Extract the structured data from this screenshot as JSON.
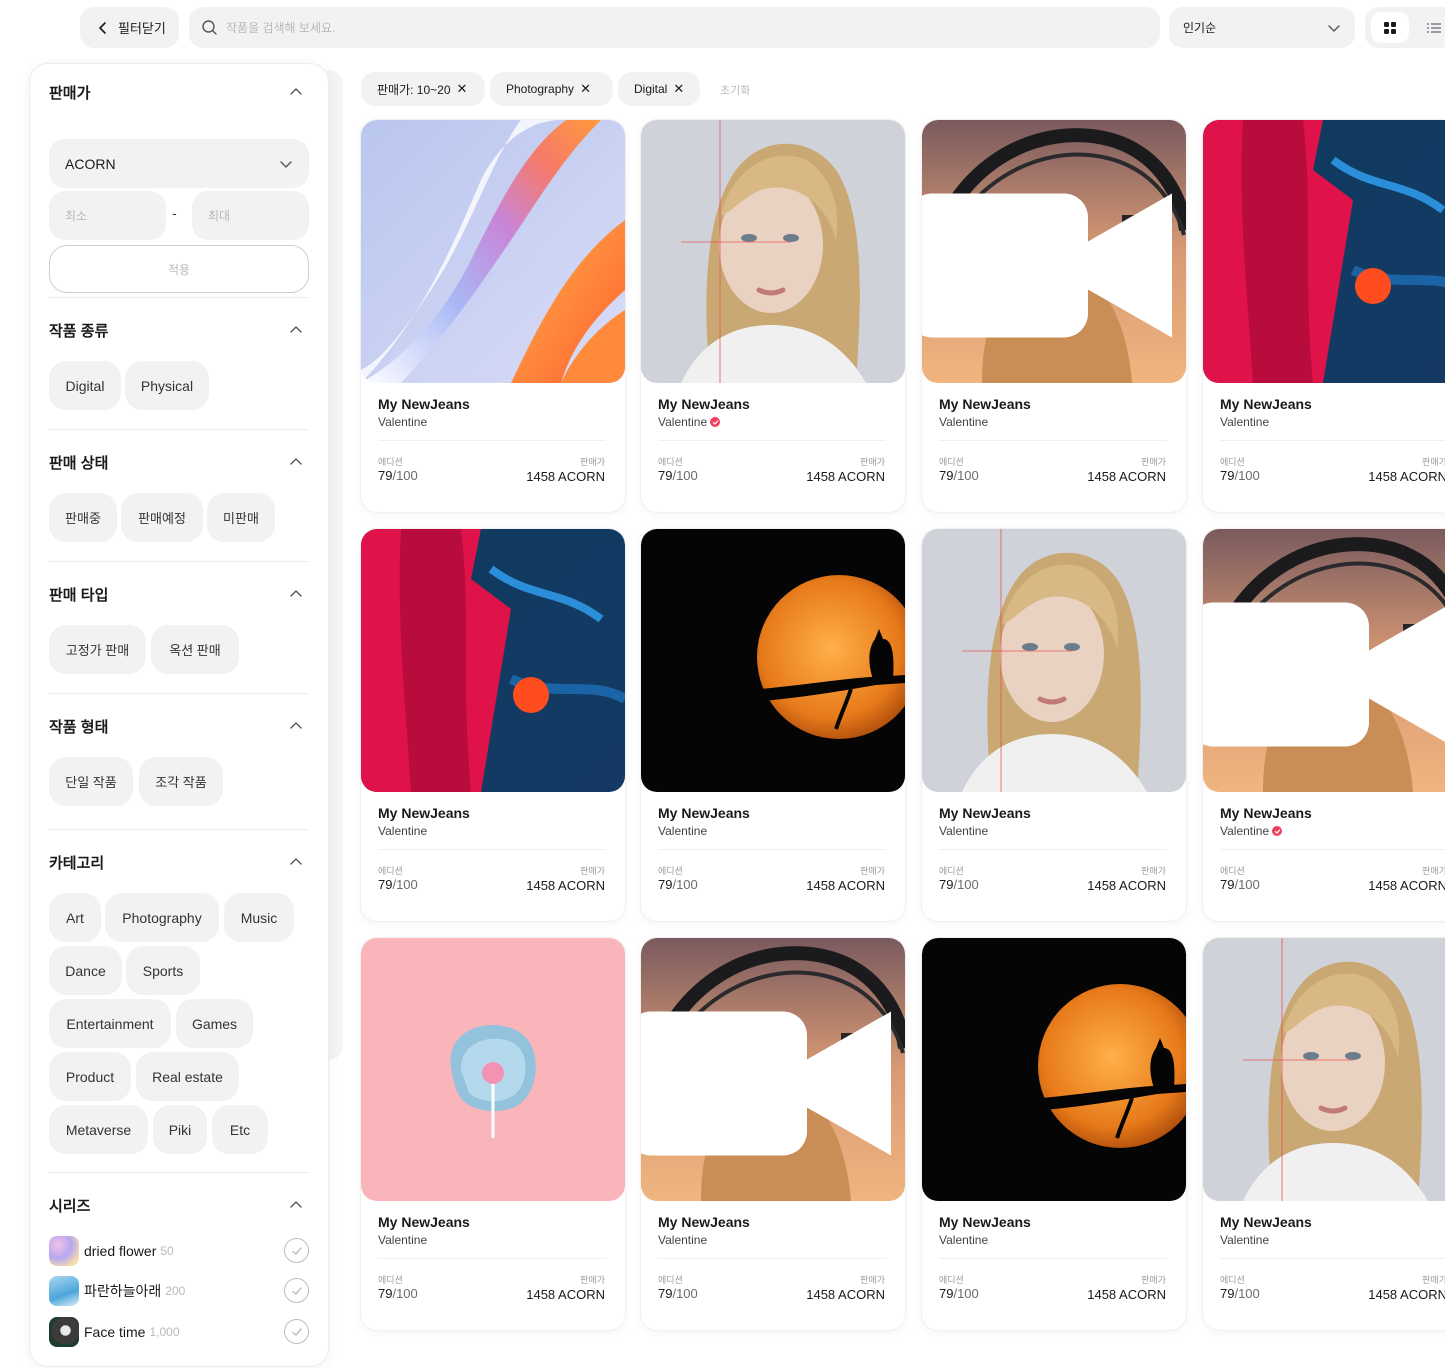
{
  "topbar": {
    "close_filter_label": "필터닫기",
    "search_placeholder": "작품을 검색해 보세요.",
    "sort_selected": "인기순"
  },
  "sidebar": {
    "seller": {
      "title": "판매가",
      "currency_selected": "ACORN",
      "min_placeholder": "최소",
      "range_separator": "-",
      "max_placeholder": "최대",
      "apply_label": "적용"
    },
    "work_type": {
      "title": "작품 종류",
      "options": [
        "Digital",
        "Physical"
      ]
    },
    "sale_status": {
      "title": "판매 상태",
      "options": [
        "판매중",
        "판매예정",
        "미판매"
      ]
    },
    "sale_type": {
      "title": "판매 타입",
      "options": [
        "고정가 판매",
        "옥션 판매"
      ]
    },
    "work_form": {
      "title": "작품 형태",
      "options": [
        "단일 작품",
        "조각 작품"
      ]
    },
    "category": {
      "title": "카테고리",
      "options": [
        "Art",
        "Photography",
        "Music",
        "Dance",
        "Sports",
        "Entertainment",
        "Games",
        "Product",
        "Real estate",
        "Metaverse",
        "Piki",
        "Etc"
      ]
    },
    "series": {
      "title": "시리즈",
      "items": [
        {
          "name": "dried flower",
          "count": "50"
        },
        {
          "name": "파란하늘아래",
          "count": "200"
        },
        {
          "name": "Face time",
          "count": "1,000"
        }
      ]
    }
  },
  "active_filters": {
    "chips": [
      "판매가: 10~20",
      "Photography",
      "Digital"
    ],
    "reset_label": "초기화"
  },
  "card_labels": {
    "edition": "에디션",
    "price": "판매가"
  },
  "cards": [
    {
      "title": "My NewJeans",
      "artist": "Valentine",
      "verified": false,
      "edition": "79",
      "edition_total": "/100",
      "price": "1458 ACORN",
      "image": "abstract-wave",
      "video": false
    },
    {
      "title": "My NewJeans",
      "artist": "Valentine",
      "verified": true,
      "edition": "79",
      "edition_total": "/100",
      "price": "1458 ACORN",
      "image": "portrait-blonde",
      "video": false
    },
    {
      "title": "My NewJeans",
      "artist": "Valentine",
      "verified": false,
      "edition": "79",
      "edition_total": "/100",
      "price": "1458 ACORN",
      "image": "bridge-sunset",
      "video": true
    },
    {
      "title": "My NewJeans",
      "artist": "Valentine",
      "verified": false,
      "edition": "79",
      "edition_total": "/100",
      "price": "1458 ACORN",
      "image": "paint-red-blue",
      "video": false
    },
    {
      "title": "My NewJeans",
      "artist": "Valentine",
      "verified": false,
      "edition": "79",
      "edition_total": "/100",
      "price": "1458 ACORN",
      "image": "paint-red-blue",
      "video": false
    },
    {
      "title": "My NewJeans",
      "artist": "Valentine",
      "verified": false,
      "edition": "79",
      "edition_total": "/100",
      "price": "1458 ACORN",
      "image": "moon-cat",
      "video": false
    },
    {
      "title": "My NewJeans",
      "artist": "Valentine",
      "verified": false,
      "edition": "79",
      "edition_total": "/100",
      "price": "1458 ACORN",
      "image": "portrait-blonde",
      "video": false
    },
    {
      "title": "My NewJeans",
      "artist": "Valentine",
      "verified": true,
      "edition": "79",
      "edition_total": "/100",
      "price": "1458 ACORN",
      "image": "bridge-sunset",
      "video": true
    },
    {
      "title": "My NewJeans",
      "artist": "Valentine",
      "verified": false,
      "edition": "79",
      "edition_total": "/100",
      "price": "1458 ACORN",
      "image": "pink-lollipop",
      "video": false
    },
    {
      "title": "My NewJeans",
      "artist": "Valentine",
      "verified": false,
      "edition": "79",
      "edition_total": "/100",
      "price": "1458 ACORN",
      "image": "bridge-sunset",
      "video": true
    },
    {
      "title": "My NewJeans",
      "artist": "Valentine",
      "verified": false,
      "edition": "79",
      "edition_total": "/100",
      "price": "1458 ACORN",
      "image": "moon-cat",
      "video": false
    },
    {
      "title": "My NewJeans",
      "artist": "Valentine",
      "verified": false,
      "edition": "79",
      "edition_total": "/100",
      "price": "1458 ACORN",
      "image": "portrait-blonde",
      "video": false
    }
  ],
  "colors": {
    "accent_verified": "#ef3e5f",
    "chip_bg": "#f2f2f3",
    "placeholder": "#b9b9bd"
  }
}
